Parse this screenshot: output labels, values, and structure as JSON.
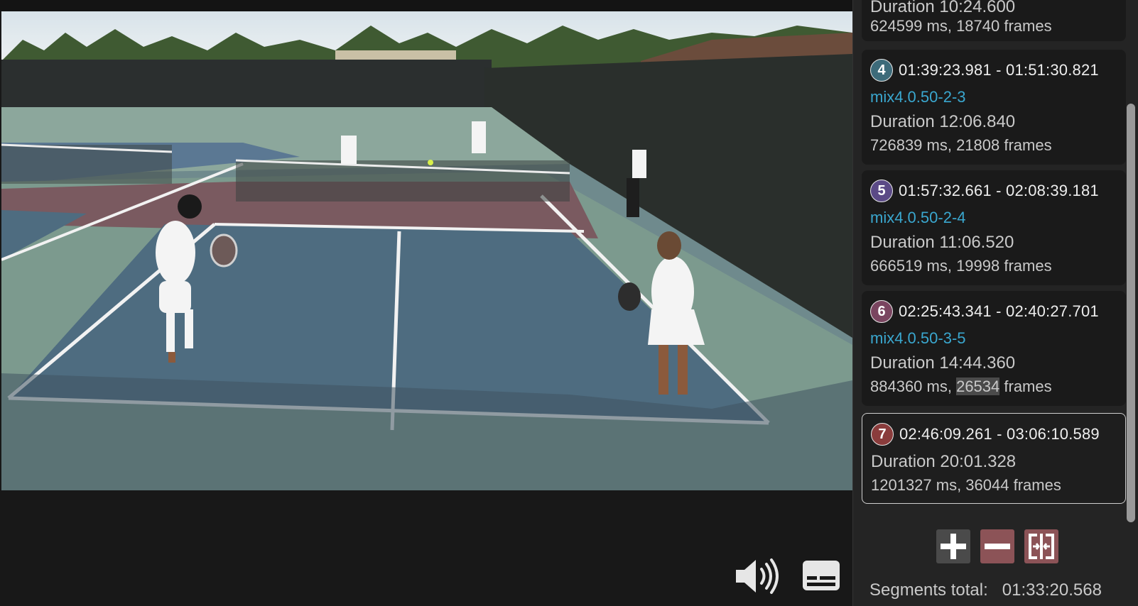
{
  "segments": [
    {
      "duration_label": "Duration 10:24.600",
      "ms_frames": "624599 ms, 18740 frames"
    },
    {
      "number": "4",
      "range": "01:39:23.981 - 01:51:30.821",
      "name": "mix4.0.50-2-3",
      "duration_label": "Duration 12:06.840",
      "ms_frames": "726839 ms, 21808 frames",
      "color": "#3d6b7a"
    },
    {
      "number": "5",
      "range": "01:57:32.661 - 02:08:39.181",
      "name": "mix4.0.50-2-4",
      "duration_label": "Duration 11:06.520",
      "ms_frames": "666519 ms, 19998 frames",
      "color": "#5b4a86"
    },
    {
      "number": "6",
      "range": "02:25:43.341 - 02:40:27.701",
      "name": "mix4.0.50-3-5",
      "duration_label": "Duration 14:44.360",
      "ms_prefix": "884360 ms, ",
      "frames_highlight": "26534",
      "frames_suffix": " frames",
      "color": "#7a4560"
    },
    {
      "number": "7",
      "range": "02:46:09.261 - 03:06:10.589",
      "duration_label": "Duration 20:01.328",
      "ms_frames": "1201327 ms, 36044 frames",
      "color": "#8a3c3c",
      "selected": true
    }
  ],
  "actions": {
    "add_icon": "plus-icon",
    "remove_icon": "minus-icon",
    "split_icon": "split-icon"
  },
  "footer": {
    "total_label": "Segments total:",
    "total_value": "01:33:20.568"
  },
  "player": {
    "volume_icon": "volume-icon",
    "subtitles_icon": "subtitles-icon"
  }
}
